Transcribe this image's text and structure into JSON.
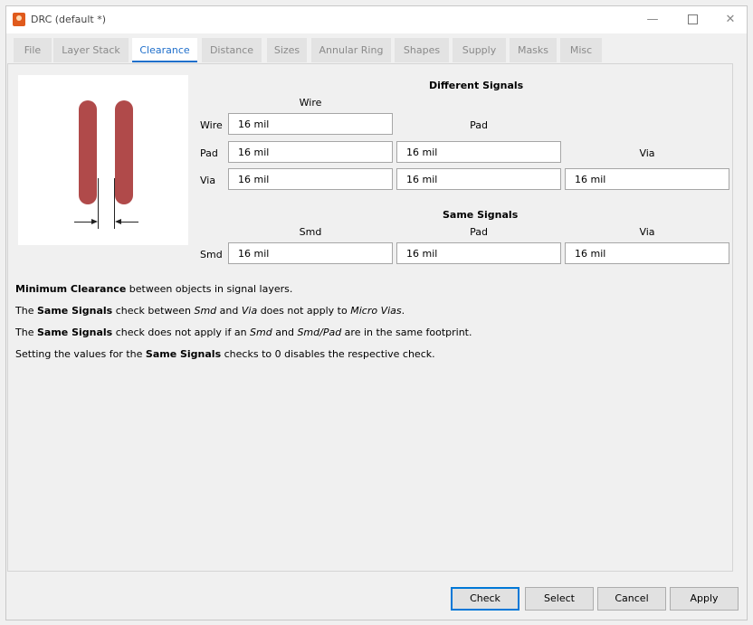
{
  "window": {
    "title": "DRC (default *)",
    "minimize_glyph": "—",
    "close_glyph": "✕"
  },
  "tabs": [
    {
      "label": "File",
      "active": false
    },
    {
      "label": "Layer Stack",
      "active": false
    },
    {
      "label": "Clearance",
      "active": true
    },
    {
      "label": "Distance",
      "active": false
    },
    {
      "label": "Sizes",
      "active": false
    },
    {
      "label": "Annular Ring",
      "active": false
    },
    {
      "label": "Shapes",
      "active": false
    },
    {
      "label": "Supply",
      "active": false
    },
    {
      "label": "Masks",
      "active": false
    },
    {
      "label": "Misc",
      "active": false
    }
  ],
  "different_signals": {
    "heading": "Different Signals",
    "columns": [
      "Wire",
      "Pad",
      "Via"
    ],
    "rows": [
      {
        "label": "Wire",
        "values": [
          "16 mil"
        ]
      },
      {
        "label": "Pad",
        "values": [
          "16 mil",
          "16 mil"
        ]
      },
      {
        "label": "Via",
        "values": [
          "16 mil",
          "16 mil",
          "16 mil"
        ]
      }
    ]
  },
  "same_signals": {
    "heading": "Same Signals",
    "columns": [
      "Smd",
      "Pad",
      "Via"
    ],
    "rows": [
      {
        "label": "Smd",
        "values": [
          "16 mil",
          "16 mil",
          "16 mil"
        ]
      }
    ]
  },
  "notes": [
    [
      {
        "t": "Minimum Clearance",
        "s": "b"
      },
      {
        "t": " between objects in signal layers.",
        "s": ""
      }
    ],
    [
      {
        "t": "The ",
        "s": ""
      },
      {
        "t": "Same Signals",
        "s": "b"
      },
      {
        "t": " check between ",
        "s": ""
      },
      {
        "t": "Smd",
        "s": "i"
      },
      {
        "t": " and ",
        "s": ""
      },
      {
        "t": "Via",
        "s": "i"
      },
      {
        "t": " does not apply to ",
        "s": ""
      },
      {
        "t": "Micro Vias",
        "s": "i"
      },
      {
        "t": ".",
        "s": ""
      }
    ],
    [
      {
        "t": "The ",
        "s": ""
      },
      {
        "t": "Same Signals",
        "s": "b"
      },
      {
        "t": " check does not apply if an ",
        "s": ""
      },
      {
        "t": "Smd",
        "s": "i"
      },
      {
        "t": " and ",
        "s": ""
      },
      {
        "t": "Smd/Pad",
        "s": "i"
      },
      {
        "t": " are in the same footprint.",
        "s": ""
      }
    ],
    [
      {
        "t": "Setting the values for the ",
        "s": ""
      },
      {
        "t": "Same Signals",
        "s": "b"
      },
      {
        "t": " checks to 0 disables the respective check.",
        "s": ""
      }
    ]
  ],
  "buttons": {
    "check": "Check",
    "select": "Select",
    "cancel": "Cancel",
    "apply": "Apply"
  },
  "colors": {
    "accent": "#1f6fcb",
    "pad_fill": "#b04a4a"
  }
}
